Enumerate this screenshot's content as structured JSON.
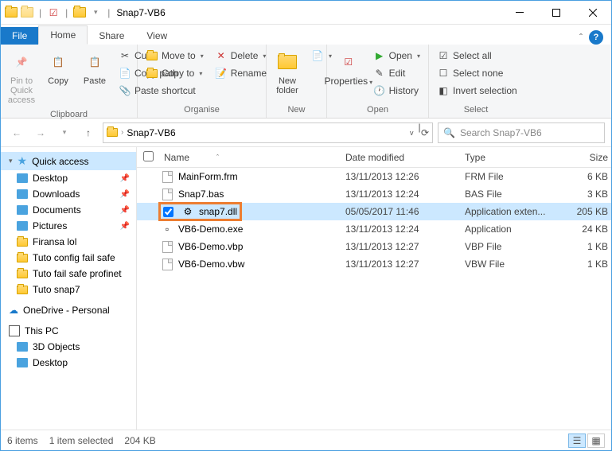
{
  "title": "Snap7-VB6",
  "tabs": {
    "file": "File",
    "home": "Home",
    "share": "Share",
    "view": "View"
  },
  "ribbon": {
    "pin": "Pin to Quick\naccess",
    "copy": "Copy",
    "paste": "Paste",
    "cut": "Cut",
    "copypath": "Copy path",
    "pasteshortcut": "Paste shortcut",
    "clipboard": "Clipboard",
    "moveto": "Move to",
    "copyto": "Copy to",
    "delete": "Delete",
    "rename": "Rename",
    "organise": "Organise",
    "newfolder": "New\nfolder",
    "new": "New",
    "properties": "Properties",
    "open": "Open",
    "edit": "Edit",
    "history": "History",
    "open_lbl": "Open",
    "selectall": "Select all",
    "selectnone": "Select none",
    "invert": "Invert selection",
    "select": "Select"
  },
  "address": {
    "path": "Snap7-VB6"
  },
  "search": {
    "placeholder": "Search Snap7-VB6"
  },
  "sidebar": {
    "quickaccess": "Quick access",
    "items": [
      "Desktop",
      "Downloads",
      "Documents",
      "Pictures",
      "Firansa lol",
      "Tuto config fail safe",
      "Tuto fail safe profinet",
      "Tuto snap7"
    ],
    "onedrive": "OneDrive - Personal",
    "thispc": "This PC",
    "objects3d": "3D Objects",
    "desktop2": "Desktop"
  },
  "columns": {
    "name": "Name",
    "date": "Date modified",
    "type": "Type",
    "size": "Size"
  },
  "files": [
    {
      "name": "MainForm.frm",
      "date": "13/11/2013 12:26",
      "type": "FRM File",
      "size": "6 KB",
      "icon": "file",
      "sel": false
    },
    {
      "name": "Snap7.bas",
      "date": "13/11/2013 12:24",
      "type": "BAS File",
      "size": "3 KB",
      "icon": "file",
      "sel": false
    },
    {
      "name": "snap7.dll",
      "date": "05/05/2017 11:46",
      "type": "Application exten...",
      "size": "205 KB",
      "icon": "gear",
      "sel": true,
      "hl": true
    },
    {
      "name": "VB6-Demo.exe",
      "date": "13/11/2013 12:24",
      "type": "Application",
      "size": "24 KB",
      "icon": "app",
      "sel": false
    },
    {
      "name": "VB6-Demo.vbp",
      "date": "13/11/2013 12:27",
      "type": "VBP File",
      "size": "1 KB",
      "icon": "file",
      "sel": false
    },
    {
      "name": "VB6-Demo.vbw",
      "date": "13/11/2013 12:27",
      "type": "VBW File",
      "size": "1 KB",
      "icon": "file",
      "sel": false
    }
  ],
  "status": {
    "count": "6 items",
    "sel": "1 item selected",
    "size": "204 KB"
  }
}
